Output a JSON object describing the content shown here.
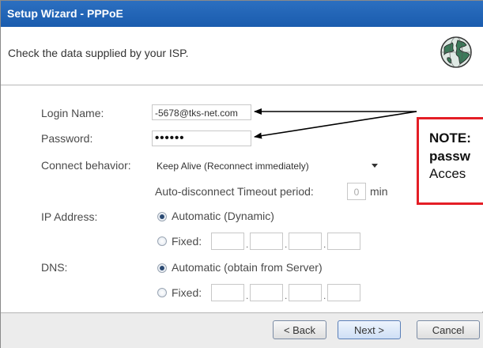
{
  "window": {
    "title": "Setup Wizard - PPPoE"
  },
  "header": {
    "message": "Check the data supplied by your ISP.",
    "logo_icon": "globe-icon"
  },
  "form": {
    "login_label": "Login Name:",
    "login_value": "-5678@tks-net.com",
    "password_label": "Password:",
    "password_value": "••••••",
    "connect_label": "Connect behavior:",
    "connect_value": "Keep Alive (Reconnect immediately)",
    "timeout_label": "Auto-disconnect Timeout period:",
    "timeout_value": "0",
    "timeout_unit": "min",
    "ip_label": "IP Address:",
    "ip_auto": "Automatic (Dynamic)",
    "ip_fixed": "Fixed:",
    "ip_selected": "automatic",
    "dns_label": "DNS:",
    "dns_auto": "Automatic (obtain from Server)",
    "dns_fixed": "Fixed:",
    "dns_selected": "automatic"
  },
  "note": {
    "line1": "NOTE:",
    "line2": "passw",
    "line3": "Acces",
    "border_color": "#e41e26"
  },
  "buttons": {
    "back": "< Back",
    "next": "Next >",
    "cancel": "Cancel"
  },
  "colors": {
    "titlebar": "#1a5cae",
    "note_border": "#e41e26"
  }
}
